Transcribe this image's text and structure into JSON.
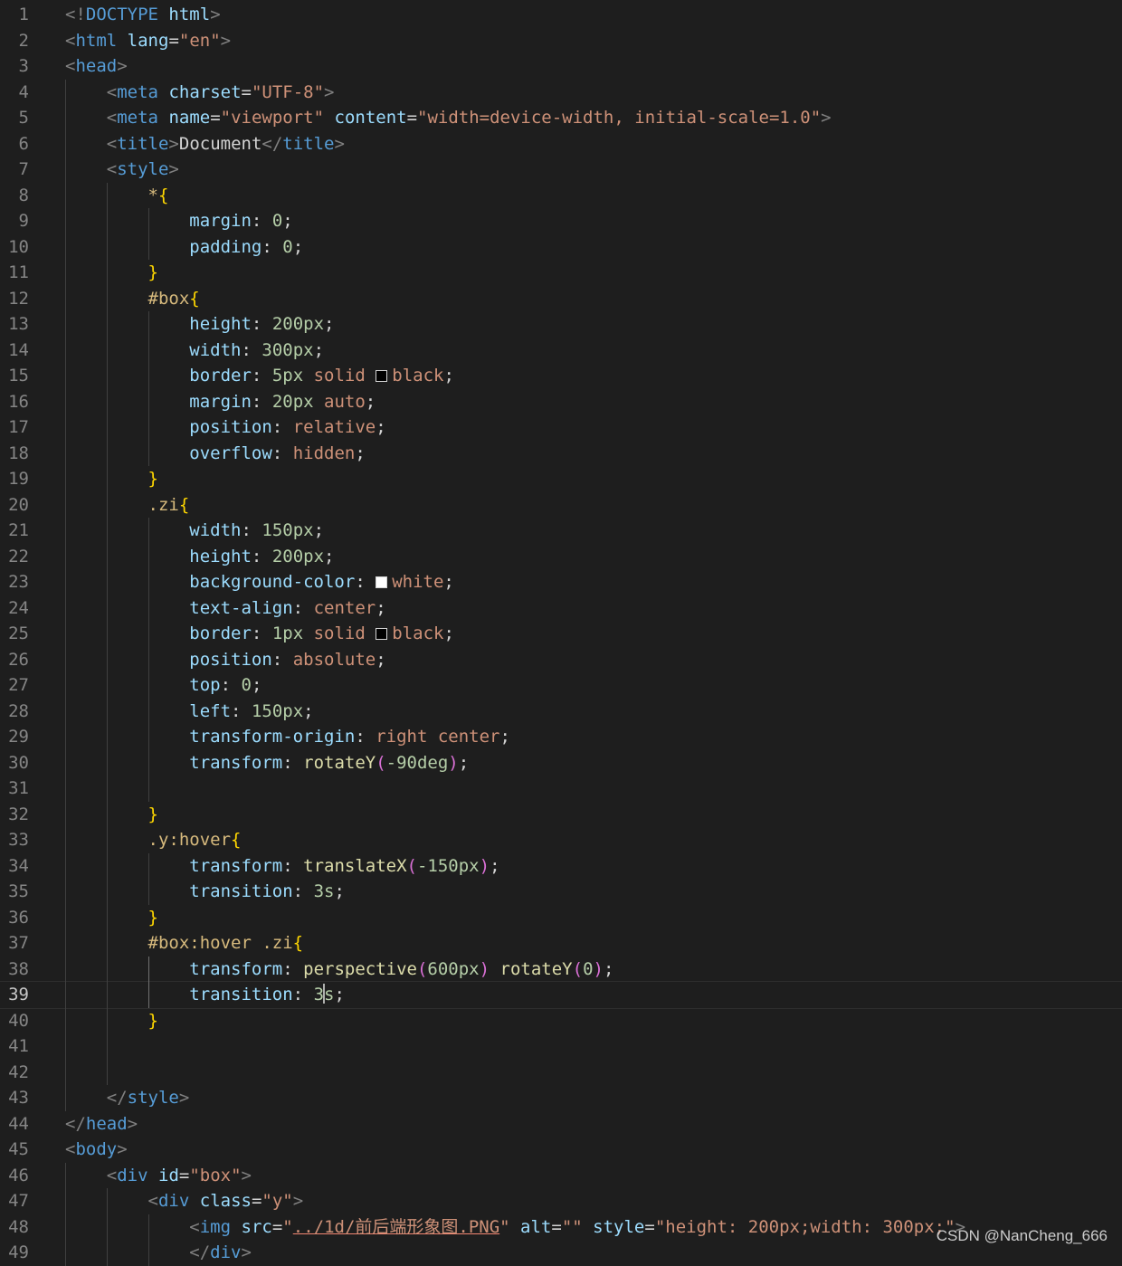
{
  "editor": {
    "cursor_line": 39,
    "theme": {
      "background": "#1e1e1e",
      "line_number": "#858585"
    },
    "colors": {
      "p": "#808080",
      "t": "#569cd6",
      "a": "#9cdcfe",
      "s": "#ce9178",
      "x": "#d4d4d4",
      "sel": "#d7ba7d",
      "prop": "#9cdcfe",
      "num": "#b5cea8",
      "fn": "#dcdcaa",
      "b1": "#ffd700",
      "b2": "#da70d6",
      "b3": "#179fff"
    },
    "lines": [
      [
        [
          "p",
          "<!"
        ],
        [
          "t",
          "DOCTYPE"
        ],
        [
          "x",
          " "
        ],
        [
          "a",
          "html"
        ],
        [
          "p",
          ">"
        ]
      ],
      [
        [
          "p",
          "<"
        ],
        [
          "t",
          "html"
        ],
        [
          "x",
          " "
        ],
        [
          "a",
          "lang"
        ],
        [
          "x",
          "="
        ],
        [
          "s",
          "\"en\""
        ],
        [
          "p",
          ">"
        ]
      ],
      [
        [
          "p",
          "<"
        ],
        [
          "t",
          "head"
        ],
        [
          "p",
          ">"
        ]
      ],
      [
        [
          "x",
          "    "
        ],
        [
          "p",
          "<"
        ],
        [
          "t",
          "meta"
        ],
        [
          "x",
          " "
        ],
        [
          "a",
          "charset"
        ],
        [
          "x",
          "="
        ],
        [
          "s",
          "\"UTF-8\""
        ],
        [
          "p",
          ">"
        ]
      ],
      [
        [
          "x",
          "    "
        ],
        [
          "p",
          "<"
        ],
        [
          "t",
          "meta"
        ],
        [
          "x",
          " "
        ],
        [
          "a",
          "name"
        ],
        [
          "x",
          "="
        ],
        [
          "s",
          "\"viewport\""
        ],
        [
          "x",
          " "
        ],
        [
          "a",
          "content"
        ],
        [
          "x",
          "="
        ],
        [
          "s",
          "\"width=device-width, initial-scale=1.0\""
        ],
        [
          "p",
          ">"
        ]
      ],
      [
        [
          "x",
          "    "
        ],
        [
          "p",
          "<"
        ],
        [
          "t",
          "title"
        ],
        [
          "p",
          ">"
        ],
        [
          "x",
          "Document"
        ],
        [
          "p",
          "</"
        ],
        [
          "t",
          "title"
        ],
        [
          "p",
          ">"
        ]
      ],
      [
        [
          "x",
          "    "
        ],
        [
          "p",
          "<"
        ],
        [
          "t",
          "style"
        ],
        [
          "p",
          ">"
        ]
      ],
      [
        [
          "x",
          "        "
        ],
        [
          "sel",
          "*"
        ],
        [
          "b1",
          "{"
        ]
      ],
      [
        [
          "x",
          "            "
        ],
        [
          "prop",
          "margin"
        ],
        [
          "x",
          ": "
        ],
        [
          "num",
          "0"
        ],
        [
          "x",
          ";"
        ]
      ],
      [
        [
          "x",
          "            "
        ],
        [
          "prop",
          "padding"
        ],
        [
          "x",
          ": "
        ],
        [
          "num",
          "0"
        ],
        [
          "x",
          ";"
        ]
      ],
      [
        [
          "x",
          "        "
        ],
        [
          "b1",
          "}"
        ]
      ],
      [
        [
          "x",
          "        "
        ],
        [
          "sel",
          "#box"
        ],
        [
          "b1",
          "{"
        ]
      ],
      [
        [
          "x",
          "            "
        ],
        [
          "prop",
          "height"
        ],
        [
          "x",
          ": "
        ],
        [
          "num",
          "200px"
        ],
        [
          "x",
          ";"
        ]
      ],
      [
        [
          "x",
          "            "
        ],
        [
          "prop",
          "width"
        ],
        [
          "x",
          ": "
        ],
        [
          "num",
          "300px"
        ],
        [
          "x",
          ";"
        ]
      ],
      [
        [
          "x",
          "            "
        ],
        [
          "prop",
          "border"
        ],
        [
          "x",
          ": "
        ],
        [
          "num",
          "5px"
        ],
        [
          "x",
          " "
        ],
        [
          "s",
          "solid"
        ],
        [
          "x",
          " "
        ],
        [
          "swatch",
          "#000000"
        ],
        [
          "s",
          "black"
        ],
        [
          "x",
          ";"
        ]
      ],
      [
        [
          "x",
          "            "
        ],
        [
          "prop",
          "margin"
        ],
        [
          "x",
          ": "
        ],
        [
          "num",
          "20px"
        ],
        [
          "x",
          " "
        ],
        [
          "s",
          "auto"
        ],
        [
          "x",
          ";"
        ]
      ],
      [
        [
          "x",
          "            "
        ],
        [
          "prop",
          "position"
        ],
        [
          "x",
          ": "
        ],
        [
          "s",
          "relative"
        ],
        [
          "x",
          ";"
        ]
      ],
      [
        [
          "x",
          "            "
        ],
        [
          "prop",
          "overflow"
        ],
        [
          "x",
          ": "
        ],
        [
          "s",
          "hidden"
        ],
        [
          "x",
          ";"
        ]
      ],
      [
        [
          "x",
          "        "
        ],
        [
          "b1",
          "}"
        ]
      ],
      [
        [
          "x",
          "        "
        ],
        [
          "sel",
          ".zi"
        ],
        [
          "b1",
          "{"
        ]
      ],
      [
        [
          "x",
          "            "
        ],
        [
          "prop",
          "width"
        ],
        [
          "x",
          ": "
        ],
        [
          "num",
          "150px"
        ],
        [
          "x",
          ";"
        ]
      ],
      [
        [
          "x",
          "            "
        ],
        [
          "prop",
          "height"
        ],
        [
          "x",
          ": "
        ],
        [
          "num",
          "200px"
        ],
        [
          "x",
          ";"
        ]
      ],
      [
        [
          "x",
          "            "
        ],
        [
          "prop",
          "background-color"
        ],
        [
          "x",
          ": "
        ],
        [
          "swatch",
          "#ffffff"
        ],
        [
          "s",
          "white"
        ],
        [
          "x",
          ";"
        ]
      ],
      [
        [
          "x",
          "            "
        ],
        [
          "prop",
          "text-align"
        ],
        [
          "x",
          ": "
        ],
        [
          "s",
          "center"
        ],
        [
          "x",
          ";"
        ]
      ],
      [
        [
          "x",
          "            "
        ],
        [
          "prop",
          "border"
        ],
        [
          "x",
          ": "
        ],
        [
          "num",
          "1px"
        ],
        [
          "x",
          " "
        ],
        [
          "s",
          "solid"
        ],
        [
          "x",
          " "
        ],
        [
          "swatch",
          "#000000"
        ],
        [
          "s",
          "black"
        ],
        [
          "x",
          ";"
        ]
      ],
      [
        [
          "x",
          "            "
        ],
        [
          "prop",
          "position"
        ],
        [
          "x",
          ": "
        ],
        [
          "s",
          "absolute"
        ],
        [
          "x",
          ";"
        ]
      ],
      [
        [
          "x",
          "            "
        ],
        [
          "prop",
          "top"
        ],
        [
          "x",
          ": "
        ],
        [
          "num",
          "0"
        ],
        [
          "x",
          ";"
        ]
      ],
      [
        [
          "x",
          "            "
        ],
        [
          "prop",
          "left"
        ],
        [
          "x",
          ": "
        ],
        [
          "num",
          "150px"
        ],
        [
          "x",
          ";"
        ]
      ],
      [
        [
          "x",
          "            "
        ],
        [
          "prop",
          "transform-origin"
        ],
        [
          "x",
          ": "
        ],
        [
          "s",
          "right center"
        ],
        [
          "x",
          ";"
        ]
      ],
      [
        [
          "x",
          "            "
        ],
        [
          "prop",
          "transform"
        ],
        [
          "x",
          ": "
        ],
        [
          "fn",
          "rotateY"
        ],
        [
          "b2",
          "("
        ],
        [
          "num",
          "-90deg"
        ],
        [
          "b2",
          ")"
        ],
        [
          "x",
          ";"
        ]
      ],
      [],
      [
        [
          "x",
          "        "
        ],
        [
          "b1",
          "}"
        ]
      ],
      [
        [
          "x",
          "        "
        ],
        [
          "sel",
          ".y:hover"
        ],
        [
          "b1",
          "{"
        ]
      ],
      [
        [
          "x",
          "            "
        ],
        [
          "prop",
          "transform"
        ],
        [
          "x",
          ": "
        ],
        [
          "fn",
          "translateX"
        ],
        [
          "b2",
          "("
        ],
        [
          "num",
          "-150px"
        ],
        [
          "b2",
          ")"
        ],
        [
          "x",
          ";"
        ]
      ],
      [
        [
          "x",
          "            "
        ],
        [
          "prop",
          "transition"
        ],
        [
          "x",
          ": "
        ],
        [
          "num",
          "3s"
        ],
        [
          "x",
          ";"
        ]
      ],
      [
        [
          "x",
          "        "
        ],
        [
          "b1",
          "}"
        ]
      ],
      [
        [
          "x",
          "        "
        ],
        [
          "sel",
          "#box:hover .zi"
        ],
        [
          "b1",
          "{"
        ]
      ],
      [
        [
          "x",
          "            "
        ],
        [
          "prop",
          "transform"
        ],
        [
          "x",
          ": "
        ],
        [
          "fn",
          "perspective"
        ],
        [
          "b2",
          "("
        ],
        [
          "num",
          "600px"
        ],
        [
          "b2",
          ")"
        ],
        [
          "x",
          " "
        ],
        [
          "fn",
          "rotateY"
        ],
        [
          "b2",
          "("
        ],
        [
          "num",
          "0"
        ],
        [
          "b2",
          ")"
        ],
        [
          "x",
          ";"
        ]
      ],
      [
        [
          "x",
          "            "
        ],
        [
          "prop",
          "transition"
        ],
        [
          "x",
          ": "
        ],
        [
          "num",
          "3"
        ],
        [
          "cursor",
          ""
        ],
        [
          "num",
          "s"
        ],
        [
          "x",
          ";"
        ]
      ],
      [
        [
          "x",
          "        "
        ],
        [
          "b1",
          "}"
        ]
      ],
      [],
      [],
      [
        [
          "x",
          "    "
        ],
        [
          "p",
          "</"
        ],
        [
          "t",
          "style"
        ],
        [
          "p",
          ">"
        ]
      ],
      [
        [
          "p",
          "</"
        ],
        [
          "t",
          "head"
        ],
        [
          "p",
          ">"
        ]
      ],
      [
        [
          "p",
          "<"
        ],
        [
          "t",
          "body"
        ],
        [
          "p",
          ">"
        ]
      ],
      [
        [
          "x",
          "    "
        ],
        [
          "p",
          "<"
        ],
        [
          "t",
          "div"
        ],
        [
          "x",
          " "
        ],
        [
          "a",
          "id"
        ],
        [
          "x",
          "="
        ],
        [
          "s",
          "\"box\""
        ],
        [
          "p",
          ">"
        ]
      ],
      [
        [
          "x",
          "        "
        ],
        [
          "p",
          "<"
        ],
        [
          "t",
          "div"
        ],
        [
          "x",
          " "
        ],
        [
          "a",
          "class"
        ],
        [
          "x",
          "="
        ],
        [
          "s",
          "\"y\""
        ],
        [
          "p",
          ">"
        ]
      ],
      [
        [
          "x",
          "            "
        ],
        [
          "p",
          "<"
        ],
        [
          "t",
          "img"
        ],
        [
          "x",
          " "
        ],
        [
          "a",
          "src"
        ],
        [
          "x",
          "="
        ],
        [
          "s",
          "\""
        ],
        [
          "su",
          "../1d/前后端形象图.PNG"
        ],
        [
          "s",
          "\""
        ],
        [
          "x",
          " "
        ],
        [
          "a",
          "alt"
        ],
        [
          "x",
          "="
        ],
        [
          "s",
          "\"\""
        ],
        [
          "x",
          " "
        ],
        [
          "a",
          "style"
        ],
        [
          "x",
          "="
        ],
        [
          "s",
          "\"height: 200px;width: 300px;\""
        ],
        [
          "p",
          ">"
        ]
      ],
      [
        [
          "x",
          "            "
        ],
        [
          "p",
          "</"
        ],
        [
          "t",
          "div"
        ],
        [
          "p",
          ">"
        ]
      ]
    ]
  },
  "watermark": "CSDN @NanCheng_666"
}
